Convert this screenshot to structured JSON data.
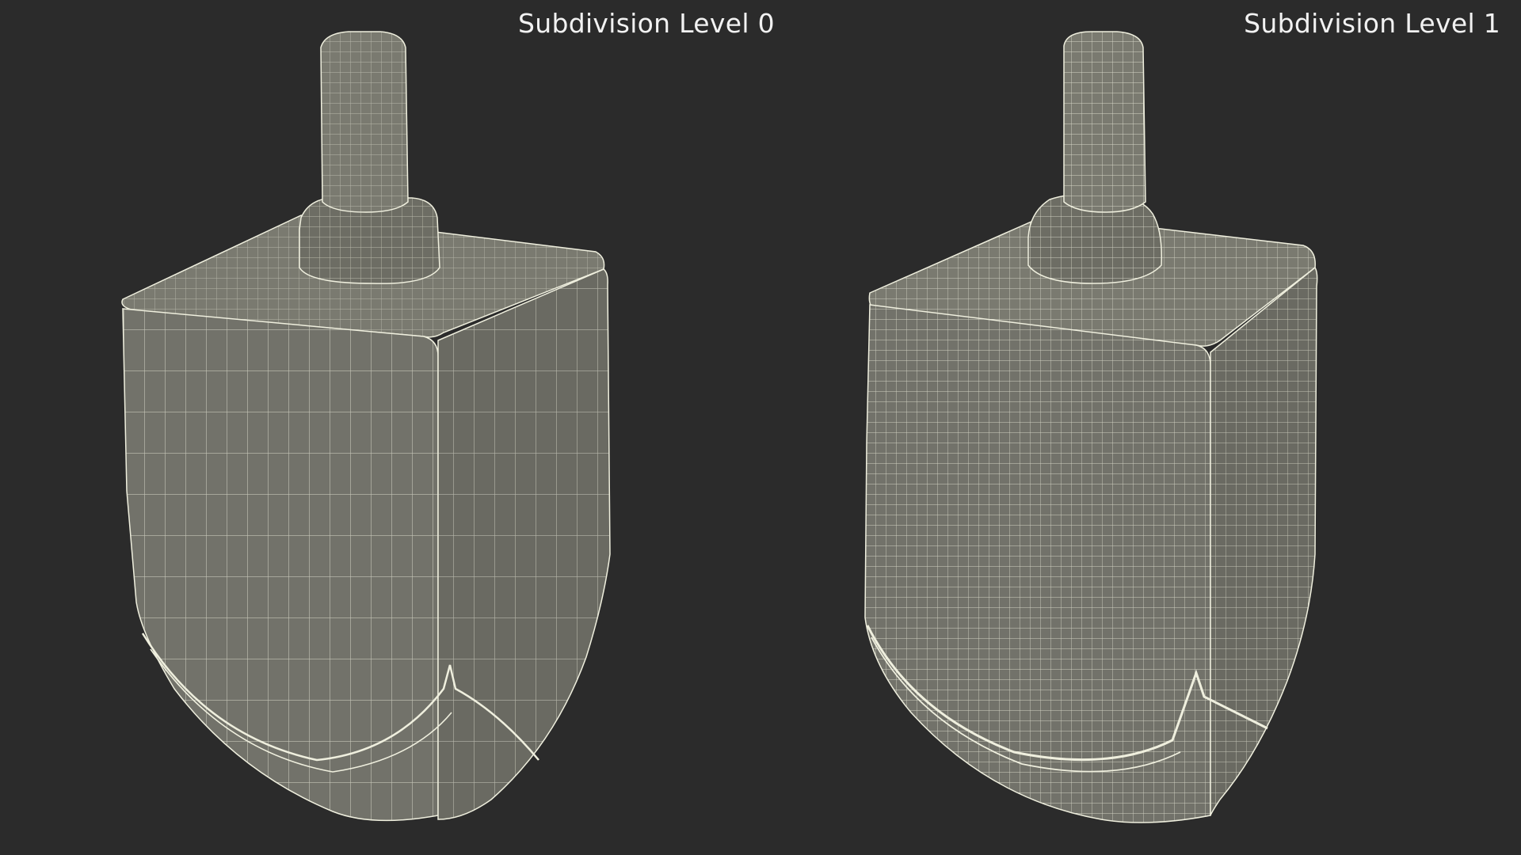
{
  "labels": {
    "left": "Subdivision Level 0",
    "right": "Subdivision Level 1"
  },
  "models": [
    {
      "name": "dreidel-subdivision-level-0",
      "subdivision_level": 0,
      "grid_columns": 14,
      "grid_rows": 12
    },
    {
      "name": "dreidel-subdivision-level-1",
      "subdivision_level": 1,
      "grid_columns": 28,
      "grid_rows": 24
    }
  ],
  "colors": {
    "background": "#2b2b2b",
    "surface": "#76766c",
    "surface_shade": "#626259",
    "surface_light": "#85857a",
    "wireframe": "#efefde",
    "text": "#f2f2f2"
  }
}
